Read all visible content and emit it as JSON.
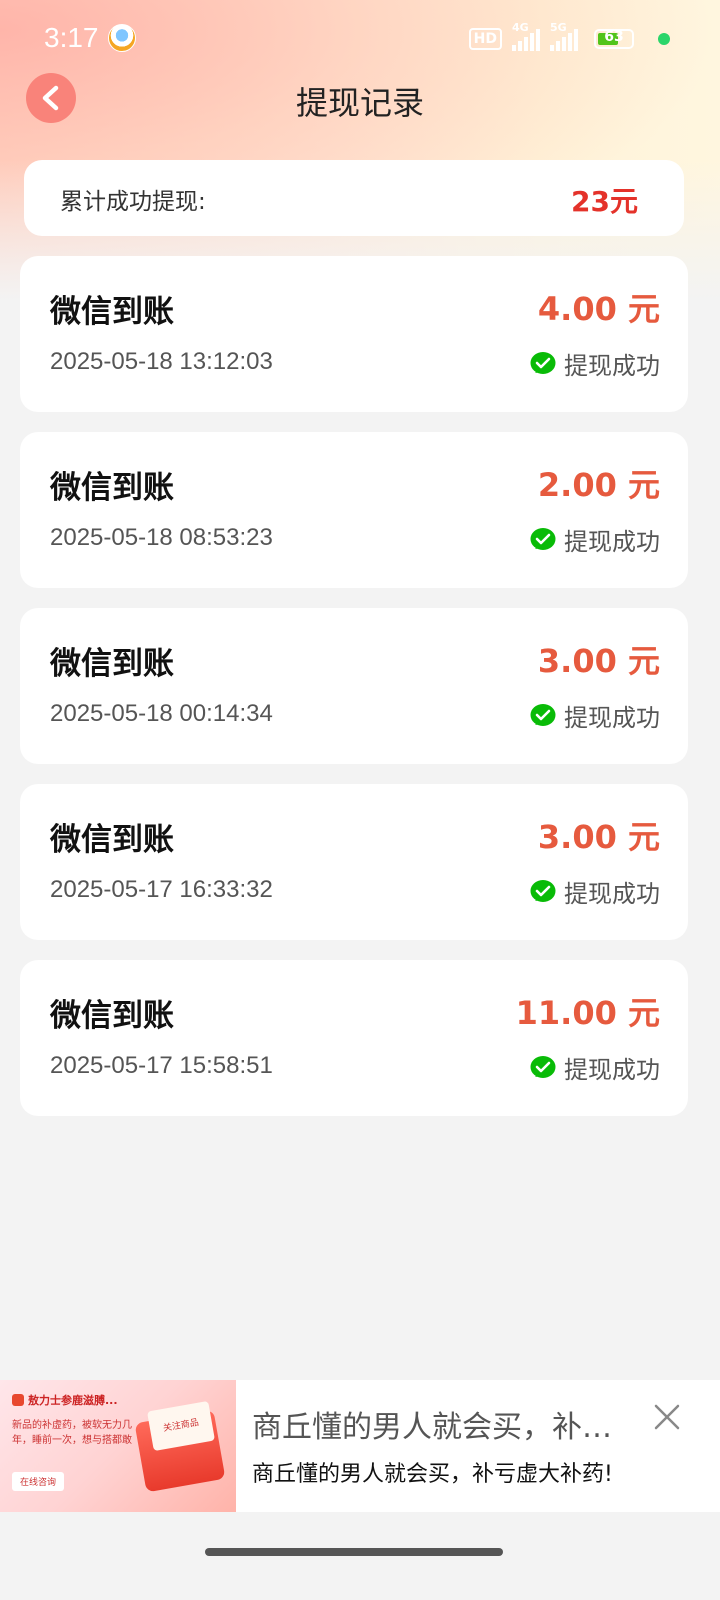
{
  "status_bar": {
    "time": "3:17",
    "hd": "HD",
    "net1": "4G",
    "net2": "5G",
    "battery": "63",
    "battery_level": 0.63
  },
  "header": {
    "title": "提现记录"
  },
  "summary": {
    "label": "累计成功提现:",
    "amount": "23元"
  },
  "records": [
    {
      "title": "微信到账",
      "amount": "4.00 元",
      "time": "2025-05-18 13:12:03",
      "status": "提现成功"
    },
    {
      "title": "微信到账",
      "amount": "2.00 元",
      "time": "2025-05-18 08:53:23",
      "status": "提现成功"
    },
    {
      "title": "微信到账",
      "amount": "3.00 元",
      "time": "2025-05-18 00:14:34",
      "status": "提现成功"
    },
    {
      "title": "微信到账",
      "amount": "3.00 元",
      "time": "2025-05-17 16:33:32",
      "status": "提现成功"
    },
    {
      "title": "微信到账",
      "amount": "11.00 元",
      "time": "2025-05-17 15:58:51",
      "status": "提现成功"
    }
  ],
  "ad": {
    "title": "商丘懂的男人就会买，补亏虚大补药！",
    "subtitle": "商丘懂的男人就会买，补亏虚大补药!",
    "image_brand": "敖力士参鹿滋膊...",
    "image_text": "新品的补虚药，被软无力几年，睡前一次，想与搭都敢",
    "image_button": "在线咨询",
    "image_card": "关注商品"
  },
  "colors": {
    "accent_red": "#e4322a",
    "amount_red": "#e65a3e",
    "back_button": "#f9837a",
    "wechat_green": "#09bb07"
  }
}
